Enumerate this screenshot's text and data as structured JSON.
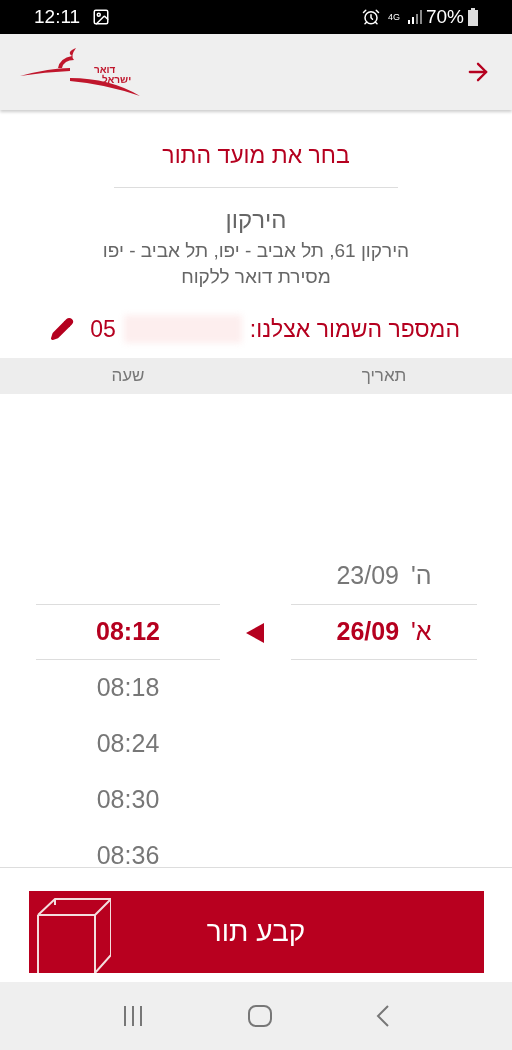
{
  "status_bar": {
    "time": "12:11",
    "network": "4G",
    "battery": "70%"
  },
  "header": {
    "logo_lines": [
      "דואר",
      "ישראל"
    ]
  },
  "title": "בחר את מועד התור",
  "branch": {
    "name": "הירקון",
    "address": "הירקון 61, תל אביב - יפו, תל אביב - יפו",
    "service": "מסירת דואר ללקוח"
  },
  "phone": {
    "label": "המספר השמור אצלנו:",
    "prefix": "05"
  },
  "columns": [
    "תאריך",
    "שעה"
  ],
  "dates": [
    {
      "weekday": "ה'",
      "date": "23/09",
      "selected": false
    },
    {
      "weekday": "א'",
      "date": "26/09",
      "selected": true
    }
  ],
  "times": [
    {
      "time": "08:12",
      "selected": true
    },
    {
      "time": "08:18",
      "selected": false
    },
    {
      "time": "08:24",
      "selected": false
    },
    {
      "time": "08:30",
      "selected": false
    },
    {
      "time": "08:36",
      "selected": false
    }
  ],
  "submit_button": "קבע תור"
}
